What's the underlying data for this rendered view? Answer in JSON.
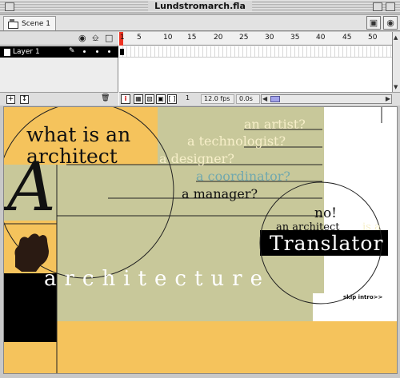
{
  "window": {
    "title": "Lundstromarch.fla"
  },
  "scene": {
    "tab_label": "Scene 1",
    "edit_symbols_icon": "edit-symbols-icon",
    "edit_scene_icon": "edit-scene-icon"
  },
  "timeline": {
    "header_icons": [
      "eye-icon",
      "lock-icon",
      "outline-icon"
    ],
    "frame_numbers": [
      "1",
      "5",
      "10",
      "15",
      "20",
      "25",
      "30",
      "35",
      "40",
      "45",
      "50"
    ],
    "layers": [
      {
        "name": "Layer 1",
        "selected": true
      }
    ],
    "footer": {
      "current_frame": "1",
      "frame_rate": "12.0 fps",
      "elapsed_time": "0.0s"
    }
  },
  "stage": {
    "headline_line1": "what is an",
    "headline_line2": "architect",
    "big_letter": "A",
    "questions": [
      "an artist?",
      "a technologist?",
      "a designer?",
      "a coordinator?",
      "a manager?"
    ],
    "answer": "no!",
    "lead": "an architect",
    "lead_suffix": "is a",
    "translator": "Translator",
    "architecture": "architecture",
    "skip_intro": "skip intro>>",
    "colors": {
      "orange": "#f5c35c",
      "sage": "#c8c89a",
      "black": "#000000",
      "white": "#ffffff",
      "light_text": "#f7efc9",
      "teal_text": "#70a8ae"
    }
  }
}
